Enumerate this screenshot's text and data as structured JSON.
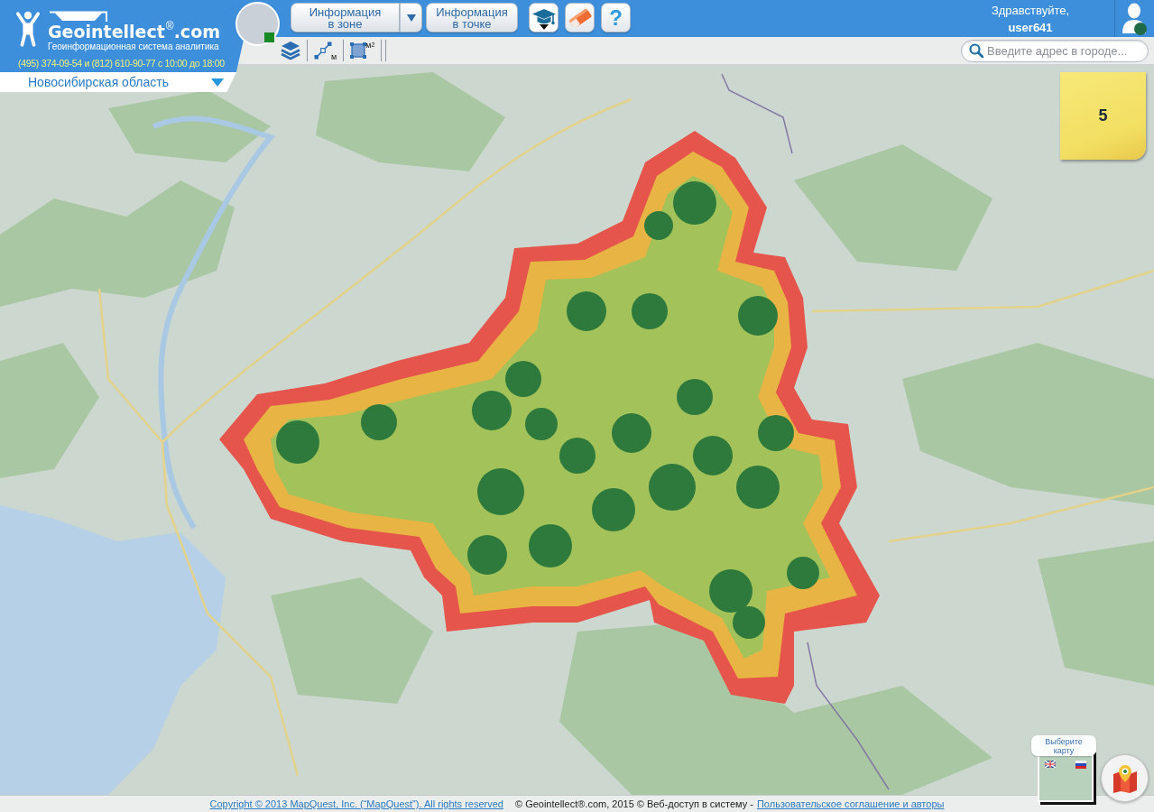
{
  "header": {
    "logo_text": "Geointellect$^{®}$.com",
    "tagline": "Геоинформационная система аналитика",
    "phone": "(495) 374-09-54 и (812) 610-90-77 с 10:00 до 18:00",
    "support_online": true
  },
  "region_select": {
    "value": "Новосибирская область"
  },
  "info_buttons": [
    {
      "kind": "split",
      "label": "Информация в зоне"
    },
    {
      "kind": "plain",
      "label": "Информация в точке"
    }
  ],
  "icon_buttons": [
    {
      "kind": "cap",
      "has_menu": true
    },
    {
      "kind": "eraser",
      "has_menu": false
    },
    {
      "kind": "help",
      "label": "?",
      "has_menu": false
    }
  ],
  "user": {
    "greeting": "Здравствуйте,",
    "name": "user641",
    "online": true
  },
  "map_tools": [
    {
      "kind": "layers"
    },
    {
      "kind": "ruler",
      "unit": "м"
    },
    {
      "kind": "area",
      "unit": "м$^{2}$"
    }
  ],
  "search": {
    "placeholder": "Введите адрес в городе..."
  },
  "notes": {
    "count": "5"
  },
  "map_switcher": {
    "label": "Выберите карту"
  },
  "footer": {
    "copyright_link": "Copyright © 2013 MapQuest, Inc. (“MapQuest”). All rights reserved",
    "notice": "© Geointellect®.com, 2015 © Веб-доступ в систему -",
    "agreement_link": "Пользовательское соглашение и авторы"
  }
}
